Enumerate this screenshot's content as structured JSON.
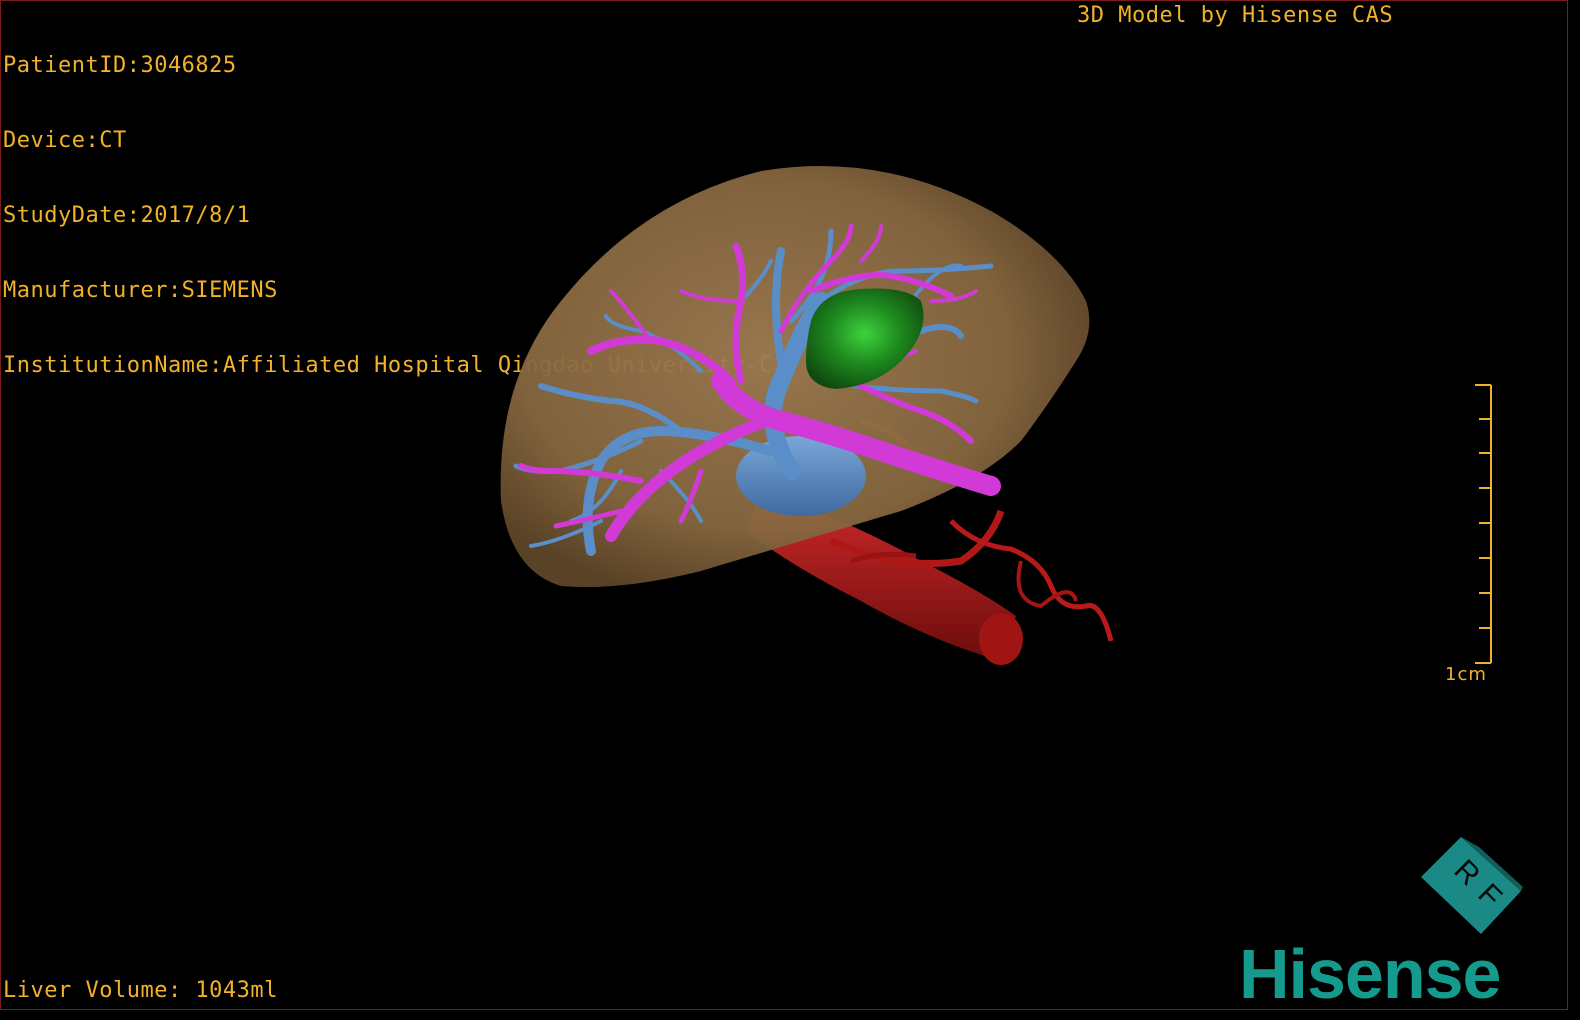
{
  "overlay": {
    "patient_id": "PatientID:3046825",
    "device": "Device:CT",
    "study_date": "StudyDate:2017/8/1",
    "manufacturer": "Manufacturer:SIEMENS",
    "institution": "InstitutionName:Affiliated Hospital Qingdao University-C",
    "model_credit": "3D Model by Hisense CAS",
    "liver_volume": "Liver Volume: 1043ml"
  },
  "scale": {
    "label": "1cm"
  },
  "orientation_cube": {
    "label_r": "R",
    "label_f": "F"
  },
  "brand": {
    "logo_text": "Hisense"
  },
  "colors": {
    "overlay_text": "#f2b12a",
    "liver": "#8a6a45",
    "portal_vein": "#d23ad8",
    "hepatic_vein": "#5a8ec8",
    "artery": "#b01818",
    "tumor": "#1e8a1e",
    "brand": "#159a8e"
  }
}
